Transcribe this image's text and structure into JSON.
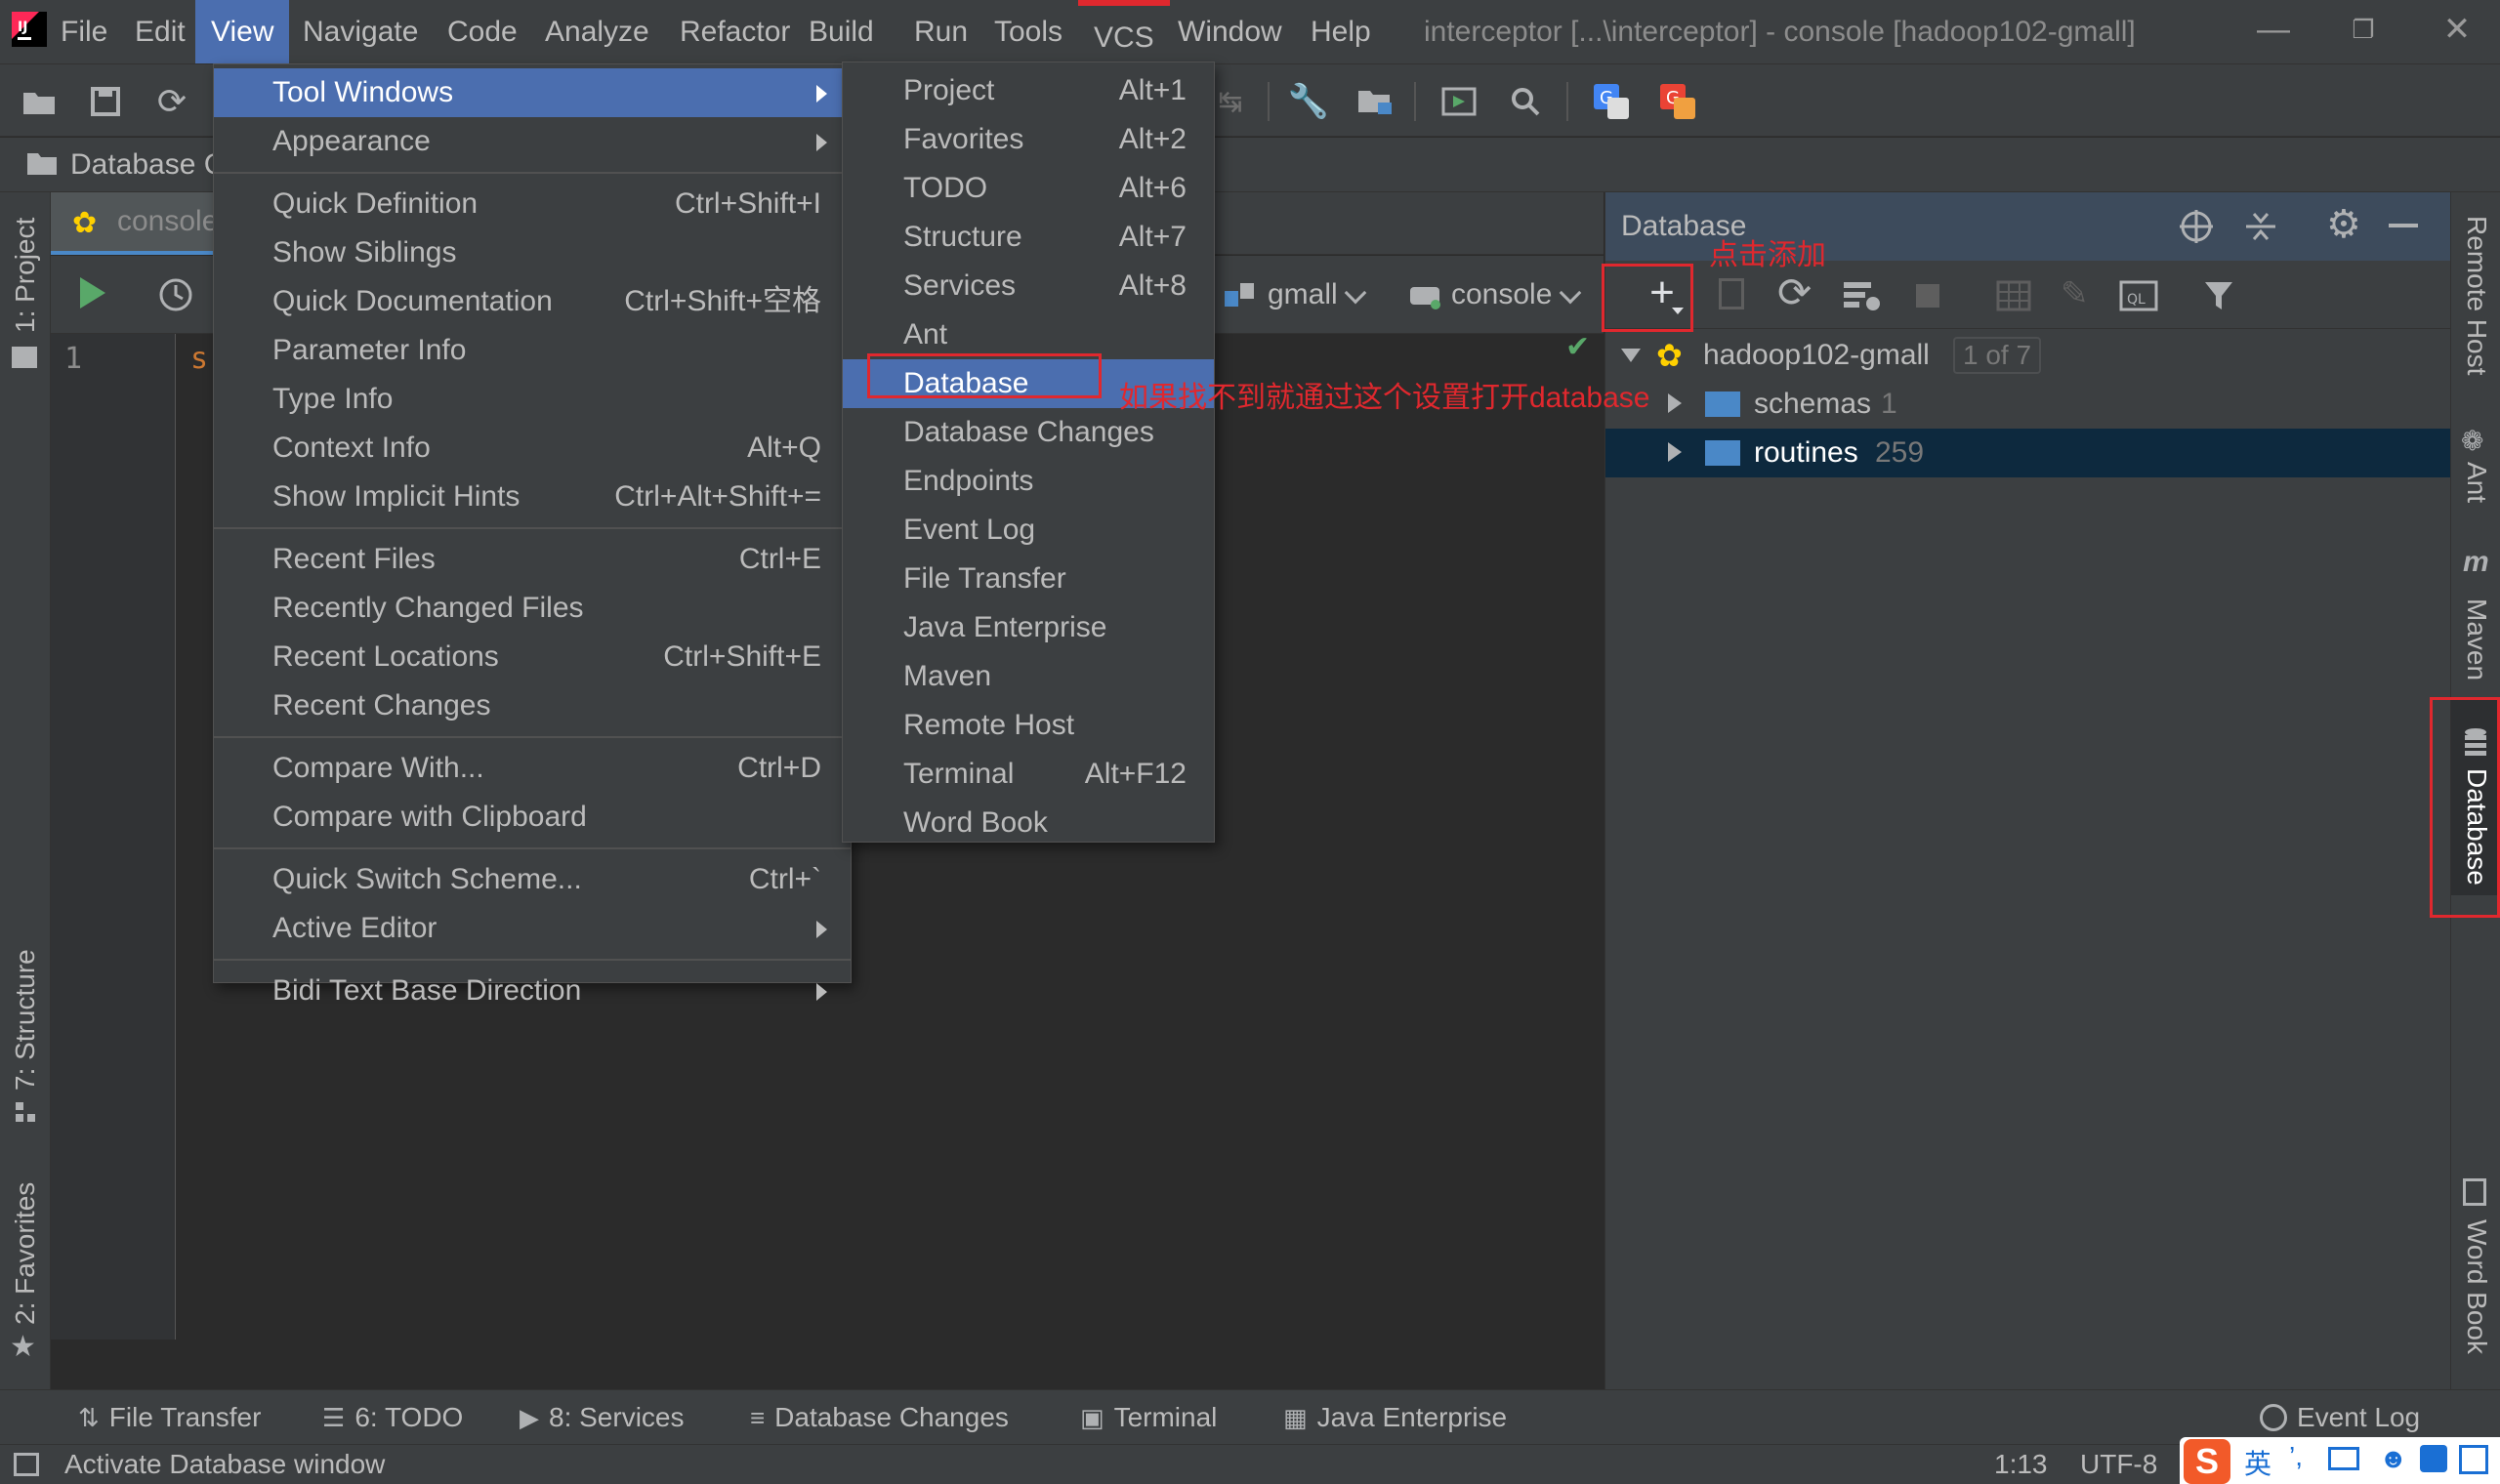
{
  "menubar": {
    "items": [
      "File",
      "Edit",
      "View",
      "Navigate",
      "Code",
      "Analyze",
      "Refactor",
      "Build",
      "Run",
      "Tools",
      "VCS",
      "Window",
      "Help"
    ],
    "title": "interceptor [...\\interceptor] - console [hadoop102-gmall]"
  },
  "navbar": {
    "breadcrumb": "Database C"
  },
  "editor": {
    "tab_label": "console",
    "line_number": "1",
    "code_fragment": "s",
    "datasource": "gmall",
    "session": "console"
  },
  "left_strip": {
    "project": "1: Project",
    "structure": "7: Structure",
    "favorites": "2: Favorites"
  },
  "right_strip": {
    "remote_host": "Remote Host",
    "ant": "Ant",
    "maven": "Maven",
    "database": "Database",
    "word_book": "Word Book"
  },
  "db_panel": {
    "title": "Database",
    "tree": [
      {
        "label": "hadoop102-gmall",
        "badge": "1 of 7"
      },
      {
        "label": "schemas",
        "count": "1"
      },
      {
        "label": "routines",
        "count": "259"
      }
    ]
  },
  "annotations": {
    "add_hint": "点击添加",
    "open_hint": "如果找不到就通过这个设置打开database"
  },
  "view_menu": {
    "groups": [
      [
        {
          "label": "Tool Windows",
          "shortcut": "",
          "submenu": true
        },
        {
          "label": "Appearance",
          "shortcut": "",
          "submenu": true
        }
      ],
      [
        {
          "label": "Quick Definition",
          "shortcut": "Ctrl+Shift+I"
        },
        {
          "label": "Show Siblings",
          "shortcut": ""
        },
        {
          "label": "Quick Documentation",
          "shortcut": "Ctrl+Shift+空格"
        },
        {
          "label": "Parameter Info",
          "shortcut": ""
        },
        {
          "label": "Type Info",
          "shortcut": ""
        },
        {
          "label": "Context Info",
          "shortcut": "Alt+Q"
        },
        {
          "label": "Show Implicit Hints",
          "shortcut": "Ctrl+Alt+Shift+="
        }
      ],
      [
        {
          "label": "Recent Files",
          "shortcut": "Ctrl+E"
        },
        {
          "label": "Recently Changed Files",
          "shortcut": ""
        },
        {
          "label": "Recent Locations",
          "shortcut": "Ctrl+Shift+E"
        },
        {
          "label": "Recent Changes",
          "shortcut": ""
        }
      ],
      [
        {
          "label": "Compare With...",
          "shortcut": "Ctrl+D"
        },
        {
          "label": "Compare with Clipboard",
          "shortcut": ""
        }
      ],
      [
        {
          "label": "Quick Switch Scheme...",
          "shortcut": "Ctrl+`"
        },
        {
          "label": "Active Editor",
          "shortcut": "",
          "submenu": true
        }
      ],
      [
        {
          "label": "Bidi Text Base Direction",
          "shortcut": "",
          "submenu": true
        }
      ]
    ]
  },
  "tool_windows_menu": [
    {
      "label": "Project",
      "shortcut": "Alt+1"
    },
    {
      "label": "Favorites",
      "shortcut": "Alt+2"
    },
    {
      "label": "TODO",
      "shortcut": "Alt+6"
    },
    {
      "label": "Structure",
      "shortcut": "Alt+7"
    },
    {
      "label": "Services",
      "shortcut": "Alt+8"
    },
    {
      "label": "Ant",
      "shortcut": ""
    },
    {
      "label": "Database",
      "shortcut": ""
    },
    {
      "label": "Database Changes",
      "shortcut": ""
    },
    {
      "label": "Endpoints",
      "shortcut": ""
    },
    {
      "label": "Event Log",
      "shortcut": ""
    },
    {
      "label": "File Transfer",
      "shortcut": ""
    },
    {
      "label": "Java Enterprise",
      "shortcut": ""
    },
    {
      "label": "Maven",
      "shortcut": ""
    },
    {
      "label": "Remote Host",
      "shortcut": ""
    },
    {
      "label": "Terminal",
      "shortcut": "Alt+F12"
    },
    {
      "label": "Word Book",
      "shortcut": ""
    }
  ],
  "bottom_tabs": [
    {
      "label": "File Transfer",
      "icon": "file-transfer-icon"
    },
    {
      "label": "6: TODO",
      "icon": "todo-icon"
    },
    {
      "label": "8: Services",
      "icon": "services-icon"
    },
    {
      "label": "Database Changes",
      "icon": "database-changes-icon"
    },
    {
      "label": "Terminal",
      "icon": "terminal-icon"
    },
    {
      "label": "Java Enterprise",
      "icon": "java-enterprise-icon"
    }
  ],
  "event_log": "Event Log",
  "status": {
    "message": "Activate Database window",
    "position": "1:13",
    "encoding": "UTF-8",
    "ime_label": "英"
  },
  "colors": {
    "accent": "#4b6eaf",
    "annotation": "#e0282e",
    "folder": "#4a88c7"
  }
}
